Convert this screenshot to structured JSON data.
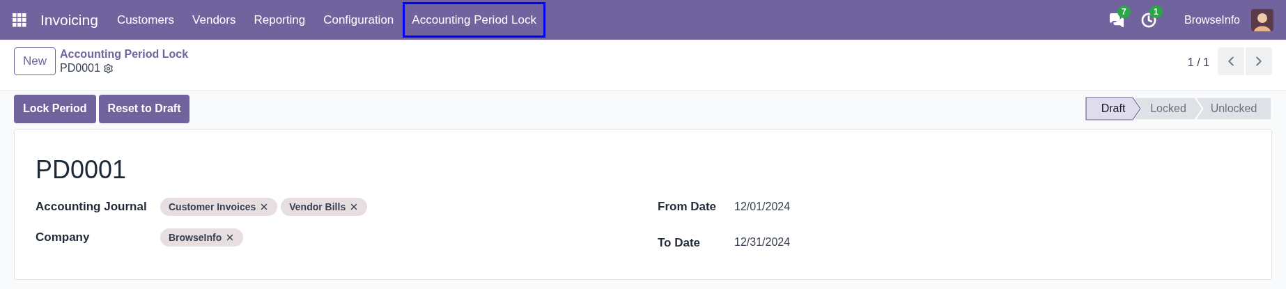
{
  "navbar": {
    "app_name": "Invoicing",
    "menu": [
      {
        "label": "Customers",
        "highlighted": false
      },
      {
        "label": "Vendors",
        "highlighted": false
      },
      {
        "label": "Reporting",
        "highlighted": false
      },
      {
        "label": "Configuration",
        "highlighted": false
      },
      {
        "label": "Accounting Period Lock",
        "highlighted": true
      }
    ],
    "messages_count": "7",
    "activities_count": "1",
    "company": "BrowseInfo"
  },
  "control_panel": {
    "new_button": "New",
    "breadcrumb": "Accounting Period Lock",
    "record_name": "PD0001",
    "pager": "1 / 1"
  },
  "actions": [
    "Lock Period",
    "Reset to Draft"
  ],
  "stages": [
    {
      "label": "Draft",
      "selected": true
    },
    {
      "label": "Locked",
      "selected": false
    },
    {
      "label": "Unlocked",
      "selected": false
    }
  ],
  "form": {
    "title": "PD0001",
    "left_fields": [
      {
        "label": "Accounting Journal",
        "tags": [
          "Customer Invoices",
          "Vendor Bills"
        ]
      },
      {
        "label": "Company",
        "tags": [
          "BrowseInfo"
        ]
      }
    ],
    "right_fields": [
      {
        "label": "From Date",
        "value": "12/01/2024"
      },
      {
        "label": "To Date",
        "value": "12/31/2024"
      }
    ]
  }
}
